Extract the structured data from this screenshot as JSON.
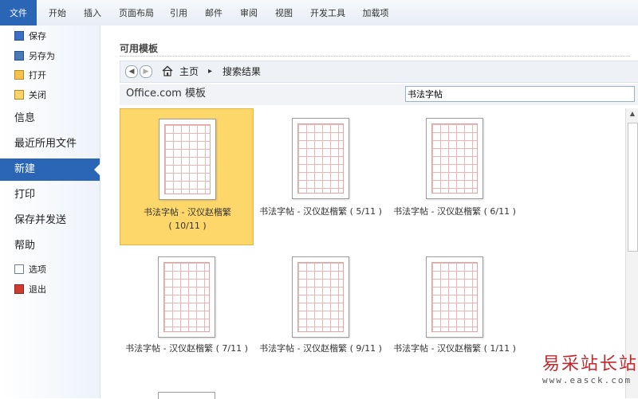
{
  "ribbon": {
    "tabs": [
      "文件",
      "开始",
      "插入",
      "页面布局",
      "引用",
      "邮件",
      "审阅",
      "视图",
      "开发工具",
      "加载项"
    ]
  },
  "sidebar": {
    "small_items_top": [
      {
        "label": "保存",
        "icon": "save-icon"
      },
      {
        "label": "另存为",
        "icon": "save-as-icon"
      },
      {
        "label": "打开",
        "icon": "open-folder-icon"
      },
      {
        "label": "关闭",
        "icon": "close-folder-icon"
      }
    ],
    "big_items": [
      "信息",
      "最近所用文件",
      "新建",
      "打印",
      "保存并发送",
      "帮助"
    ],
    "active_item": "新建",
    "small_items_bottom": [
      {
        "label": "选项",
        "icon": "options-icon"
      },
      {
        "label": "退出",
        "icon": "exit-icon"
      }
    ]
  },
  "main": {
    "heading": "可用模板",
    "breadcrumb": {
      "home": "主页",
      "separator": "▸",
      "current": "搜索结果"
    },
    "source_label": "Office.com 模板",
    "search_value": "书法字帖",
    "search_go": "➔",
    "templates": [
      {
        "line1": "书法字帖 - 汉仪赵楷繁",
        "line2": "( 10/11 )",
        "selected": true
      },
      {
        "line1": "书法字帖 - 汉仪赵楷繁 ( 5/11 )",
        "line2": "",
        "selected": false
      },
      {
        "line1": "书法字帖 - 汉仪赵楷繁 ( 6/11 )",
        "line2": "",
        "selected": false
      },
      {
        "line1": "书法字帖 - 汉仪赵楷繁 ( 7/11 )",
        "line2": "",
        "selected": false
      },
      {
        "line1": "书法字帖 - 汉仪赵楷繁 ( 9/11 )",
        "line2": "",
        "selected": false
      },
      {
        "line1": "书法字帖 - 汉仪赵楷繁 ( 1/11 )",
        "line2": "",
        "selected": false
      }
    ]
  },
  "watermark": {
    "title": "易采站长站",
    "url": "www.easck.com"
  },
  "colors": {
    "accent": "#2a66b5",
    "selected_card": "#fed76b",
    "watermark": "#c0282d"
  }
}
